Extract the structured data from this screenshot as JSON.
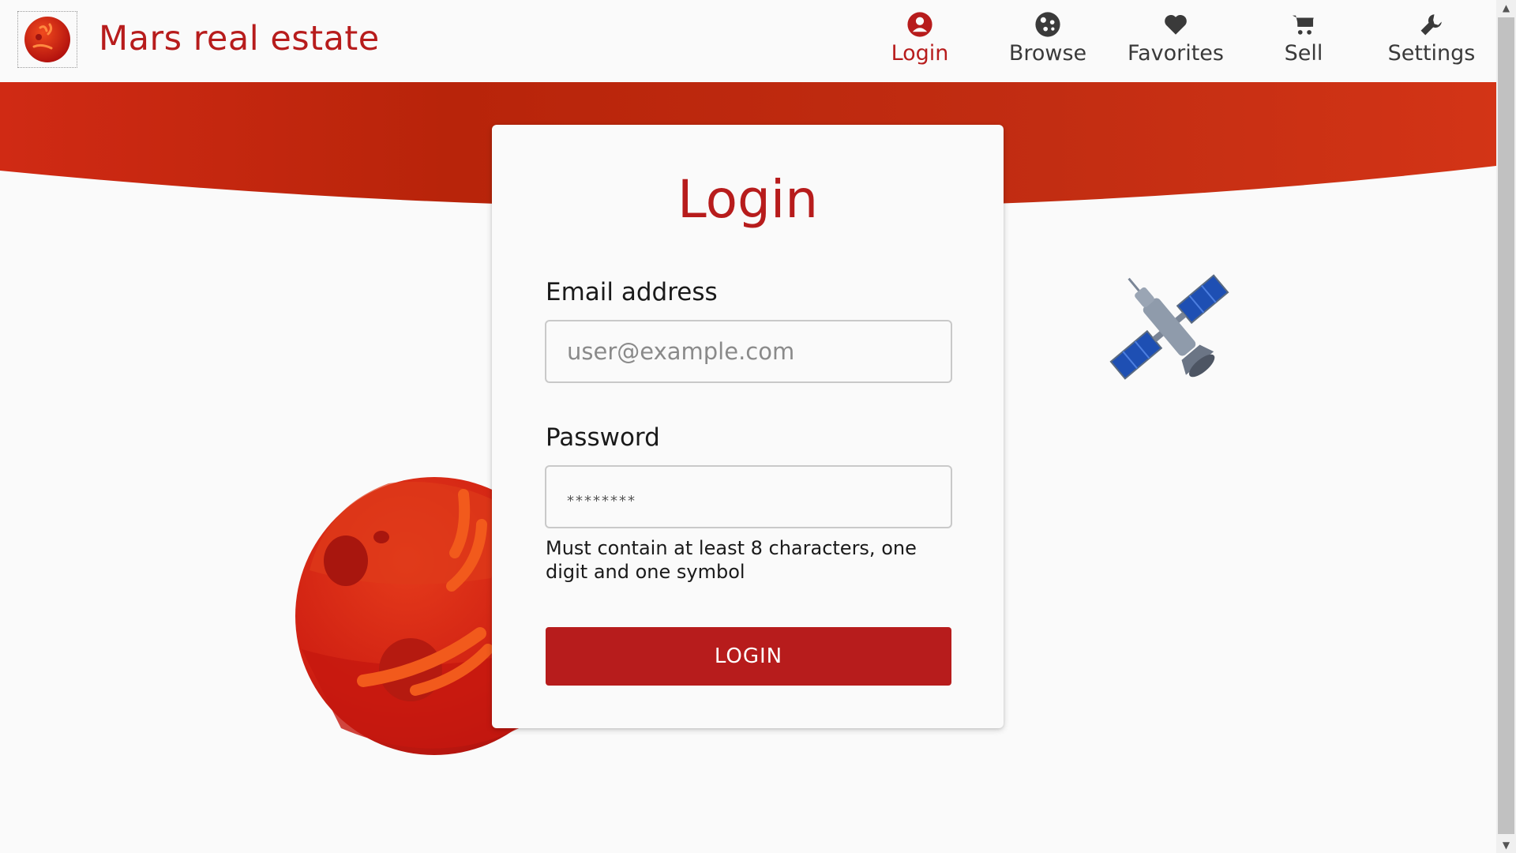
{
  "header": {
    "brand": "Mars real estate",
    "logo_icon": "mars-logo-icon"
  },
  "nav": {
    "items": [
      {
        "label": "Login",
        "icon": "account-circle-icon",
        "active": true
      },
      {
        "label": "Browse",
        "icon": "planet-icon",
        "active": false
      },
      {
        "label": "Favorites",
        "icon": "heart-icon",
        "active": false
      },
      {
        "label": "Sell",
        "icon": "cart-icon",
        "active": false
      },
      {
        "label": "Settings",
        "icon": "wrench-icon",
        "active": false
      }
    ]
  },
  "login_card": {
    "title": "Login",
    "email_label": "Email address",
    "email_placeholder": "user@example.com",
    "email_value": "",
    "password_label": "Password",
    "password_mask": "********",
    "password_hint": "Must contain at least 8 characters, one digit and one symbol",
    "submit_label": "LOGIN"
  },
  "colors": {
    "brand": "#b71c1c",
    "banner": "#c62b12",
    "background": "#fafafa"
  }
}
